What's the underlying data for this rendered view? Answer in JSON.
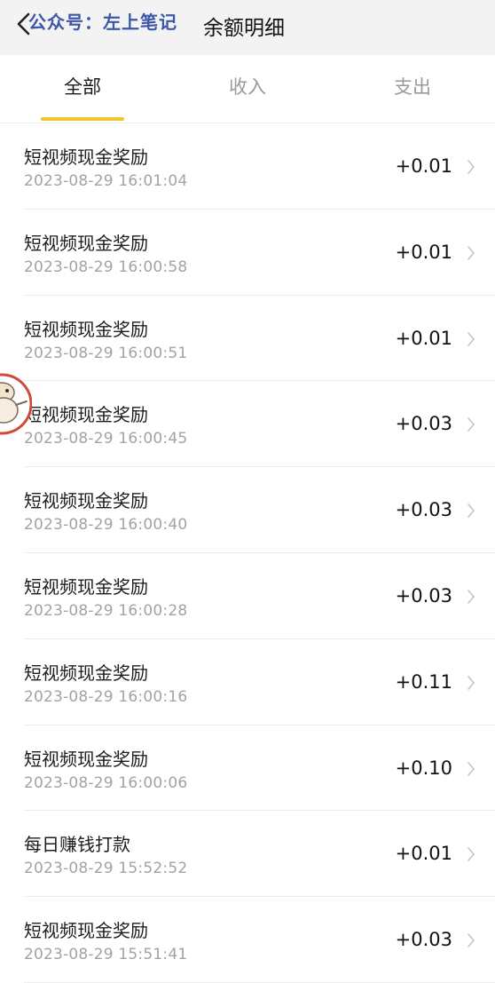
{
  "header": {
    "watermark": "公众号：左上笔记",
    "title": "余额明细",
    "icons": {
      "back": "chevron-left-icon"
    }
  },
  "tabs": [
    {
      "label": "全部",
      "active": true
    },
    {
      "label": "收入",
      "active": false
    },
    {
      "label": "支出",
      "active": false
    }
  ],
  "colors": {
    "accent": "#f2c52b",
    "watermark": "#3d57a8",
    "header_bg": "#f3f3f3"
  },
  "transactions": [
    {
      "title": "短视频现金奖励",
      "time": "2023-08-29 16:01:04",
      "amount": "+0.01"
    },
    {
      "title": "短视频现金奖励",
      "time": "2023-08-29 16:00:58",
      "amount": "+0.01"
    },
    {
      "title": "短视频现金奖励",
      "time": "2023-08-29 16:00:51",
      "amount": "+0.01"
    },
    {
      "title": "短视频现金奖励",
      "time": "2023-08-29 16:00:45",
      "amount": "+0.03"
    },
    {
      "title": "短视频现金奖励",
      "time": "2023-08-29 16:00:40",
      "amount": "+0.03"
    },
    {
      "title": "短视频现金奖励",
      "time": "2023-08-29 16:00:28",
      "amount": "+0.03"
    },
    {
      "title": "短视频现金奖励",
      "time": "2023-08-29 16:00:16",
      "amount": "+0.11"
    },
    {
      "title": "短视频现金奖励",
      "time": "2023-08-29 16:00:06",
      "amount": "+0.10"
    },
    {
      "title": "每日赚钱打款",
      "time": "2023-08-29 15:52:52",
      "amount": "+0.01"
    },
    {
      "title": "短视频现金奖励",
      "time": "2023-08-29 15:51:41",
      "amount": "+0.03"
    }
  ]
}
